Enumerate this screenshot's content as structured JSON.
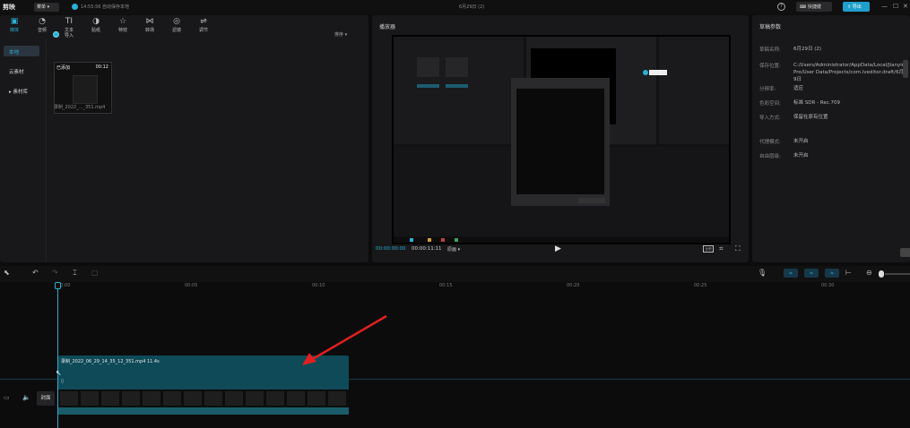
{
  "topbar": {
    "logo": "剪映",
    "menu_label": "菜单",
    "autosave": "14:55:56 自动保存本地",
    "project_title": "6月29日 (2)",
    "help": "?",
    "shortcut_label": "快捷键",
    "export_label": "导出",
    "min": "—",
    "max": "☐",
    "close": "✕"
  },
  "toolbar": {
    "items": [
      {
        "label": "媒体",
        "icon": "▣"
      },
      {
        "label": "音频",
        "icon": "◔"
      },
      {
        "label": "文本",
        "icon": "TI"
      },
      {
        "label": "贴纸",
        "icon": "◑"
      },
      {
        "label": "特效",
        "icon": "☆"
      },
      {
        "label": "转场",
        "icon": "⋈"
      },
      {
        "label": "滤镜",
        "icon": "◎"
      },
      {
        "label": "调节",
        "icon": "⇌"
      }
    ]
  },
  "side_nav": [
    "本地",
    "云素材",
    "▸ 素材库"
  ],
  "media": {
    "import_label": "导入",
    "sort_label": "排序 ▾",
    "thumb_added": "已添加",
    "thumb_duration": "00:12",
    "file_name": "录制_2022_..._351.mp4"
  },
  "player": {
    "title": "播放器",
    "time_current": "00:00:00:00",
    "time_total": "00:00:11:11",
    "quality": "原画 ▾",
    "play": "▶",
    "ratio": "比例",
    "crop": "⌗",
    "fullscreen": "⛶"
  },
  "properties": {
    "title": "草稿参数",
    "rows": [
      {
        "label": "草稿名称:",
        "value": "6月29日 (2)"
      },
      {
        "label": "保存位置:",
        "value": "C:/Users/Administrator/AppData/Local/JianyingPro/User Data/Projects/com.lveditor.draft/6月29日"
      },
      {
        "label": "分辨率:",
        "value": "适应"
      },
      {
        "label": "色彩空间:",
        "value": "标准 SDR - Rec.709"
      },
      {
        "label": "导入方式:",
        "value": "保留在原有位置"
      },
      {
        "label": "代理模式:",
        "value": "未开启"
      },
      {
        "label": "自由层级:",
        "value": "未开启"
      }
    ]
  },
  "timeline": {
    "ticks": [
      "00:00",
      "00:05",
      "00:10",
      "00:15",
      "00:20",
      "00:25",
      "00:30"
    ],
    "clip_title": "录制_2022_06_29_14_35_12_351.mp4  11.4s",
    "cover_label": "封面",
    "toggles": [
      "⇆",
      "⇆",
      "⇆",
      "⇆"
    ]
  },
  "colors": {
    "accent": "#2ab0d4",
    "clip": "#0e4a58",
    "panel": "#18181a",
    "arrow": "#e02020"
  }
}
